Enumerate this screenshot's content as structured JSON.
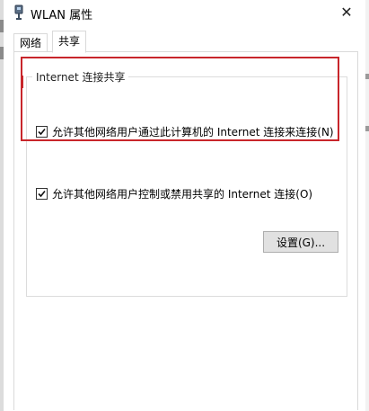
{
  "window": {
    "title": "WLAN 属性",
    "close_glyph": "✕"
  },
  "tabs": [
    {
      "label": "网络",
      "active": false
    },
    {
      "label": "共享",
      "active": true
    }
  ],
  "group": {
    "title": "Internet 连接共享",
    "allow_other_users_connect": {
      "label": "允许其他网络用户通过此计算机的 Internet 连接来连接(N)",
      "checked": true
    },
    "allow_other_users_control": {
      "label": "允许其他网络用户控制或禁用共享的 Internet 连接(O)",
      "checked": true
    },
    "settings_button": "设置(G)..."
  },
  "colors": {
    "highlight_border": "#c8262b",
    "button_bg": "#e1e1e1"
  }
}
